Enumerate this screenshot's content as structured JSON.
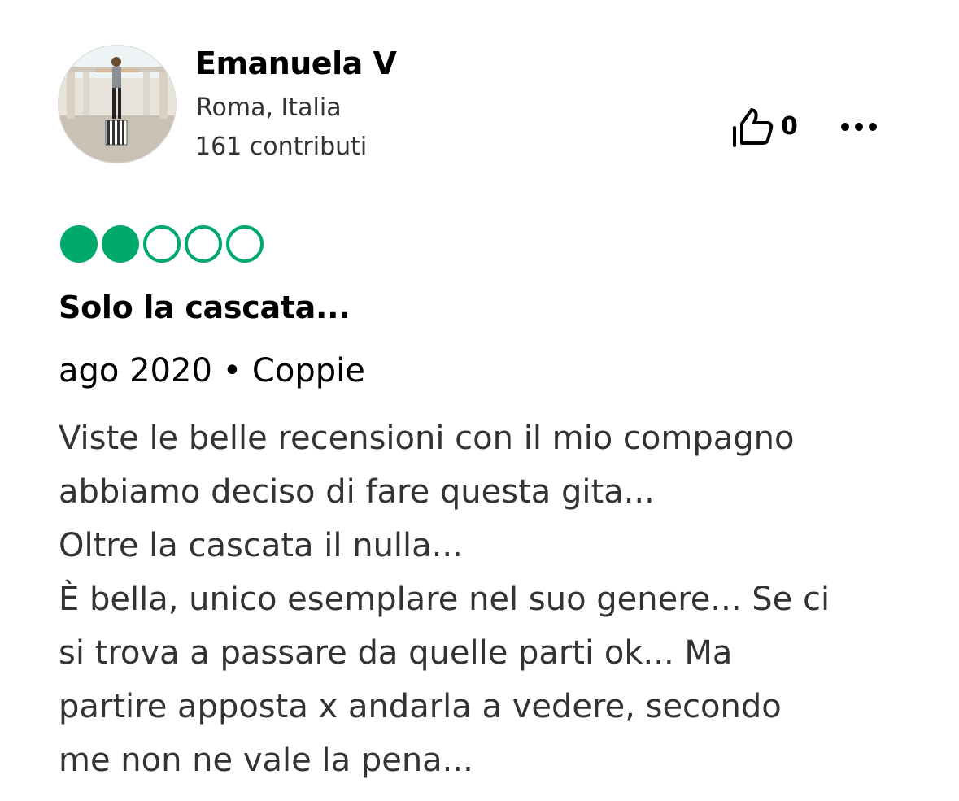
{
  "user": {
    "name": "Emanuela V",
    "location": "Roma, Italia",
    "contributions": "161 contributi"
  },
  "actions": {
    "helpful_count": "0",
    "helpful_icon": "thumbs-up-icon",
    "more_icon": "more-options-icon"
  },
  "review": {
    "rating": 2,
    "rating_max": 5,
    "rating_color": "#00aa6c",
    "title": "Solo la cascata...",
    "meta": "ago 2020 • Coppie",
    "body_lines": [
      "Viste le belle recensioni con il mio compagno",
      "abbiamo deciso di fare questa gita...",
      "Oltre la cascata il nulla...",
      "È bella, unico esemplare nel suo genere... Se ci",
      "si trova a passare da quelle parti ok... Ma",
      "partire apposta x andarla a vedere, secondo",
      "me non ne vale la pena..."
    ]
  }
}
